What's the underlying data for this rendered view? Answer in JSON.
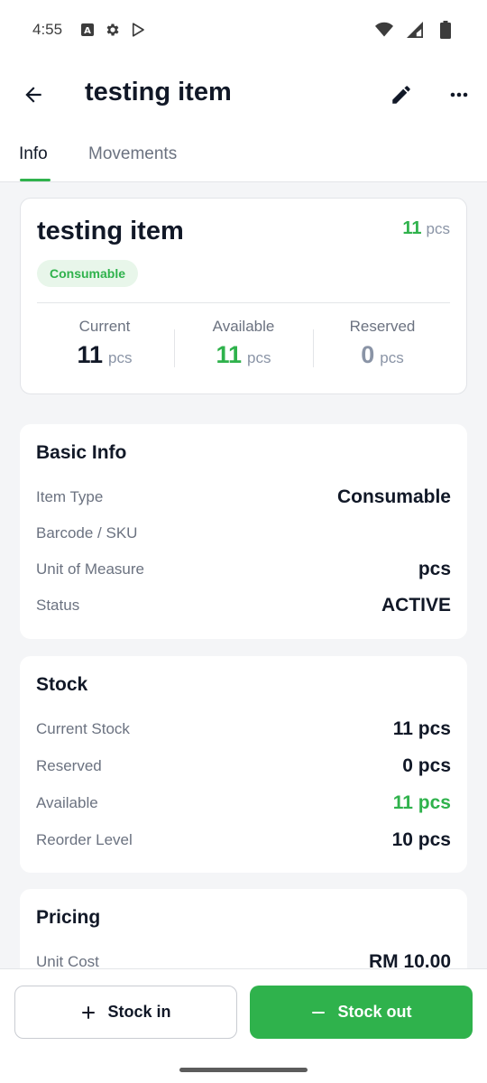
{
  "status_bar": {
    "time": "4:55"
  },
  "header": {
    "title": "testing item"
  },
  "tabs": [
    {
      "label": "Info",
      "active": true
    },
    {
      "label": "Movements",
      "active": false
    }
  ],
  "summary": {
    "name": "testing item",
    "quantity": "11",
    "unit": "pcs",
    "type_chip": "Consumable",
    "stats": {
      "current": {
        "label": "Current",
        "value": "11",
        "unit": "pcs"
      },
      "available": {
        "label": "Available",
        "value": "11",
        "unit": "pcs"
      },
      "reserved": {
        "label": "Reserved",
        "value": "0",
        "unit": "pcs"
      }
    }
  },
  "basic_info": {
    "title": "Basic Info",
    "rows": [
      {
        "label": "Item Type",
        "value": "Consumable"
      },
      {
        "label": "Barcode / SKU",
        "value": ""
      },
      {
        "label": "Unit of Measure",
        "value": "pcs"
      },
      {
        "label": "Status",
        "value": "ACTIVE"
      }
    ]
  },
  "stock": {
    "title": "Stock",
    "rows": [
      {
        "label": "Current Stock",
        "value": "11 pcs"
      },
      {
        "label": "Reserved",
        "value": "0 pcs"
      },
      {
        "label": "Available",
        "value": "11 pcs"
      },
      {
        "label": "Reorder Level",
        "value": "10 pcs"
      }
    ]
  },
  "pricing": {
    "title": "Pricing",
    "rows": [
      {
        "label": "Unit Cost",
        "value": "RM 10.00"
      }
    ]
  },
  "actions": {
    "stock_in": "Stock in",
    "stock_out": "Stock out"
  },
  "colors": {
    "accent": "#2fb24c",
    "text_primary": "#111827",
    "text_secondary": "#6b7280"
  }
}
